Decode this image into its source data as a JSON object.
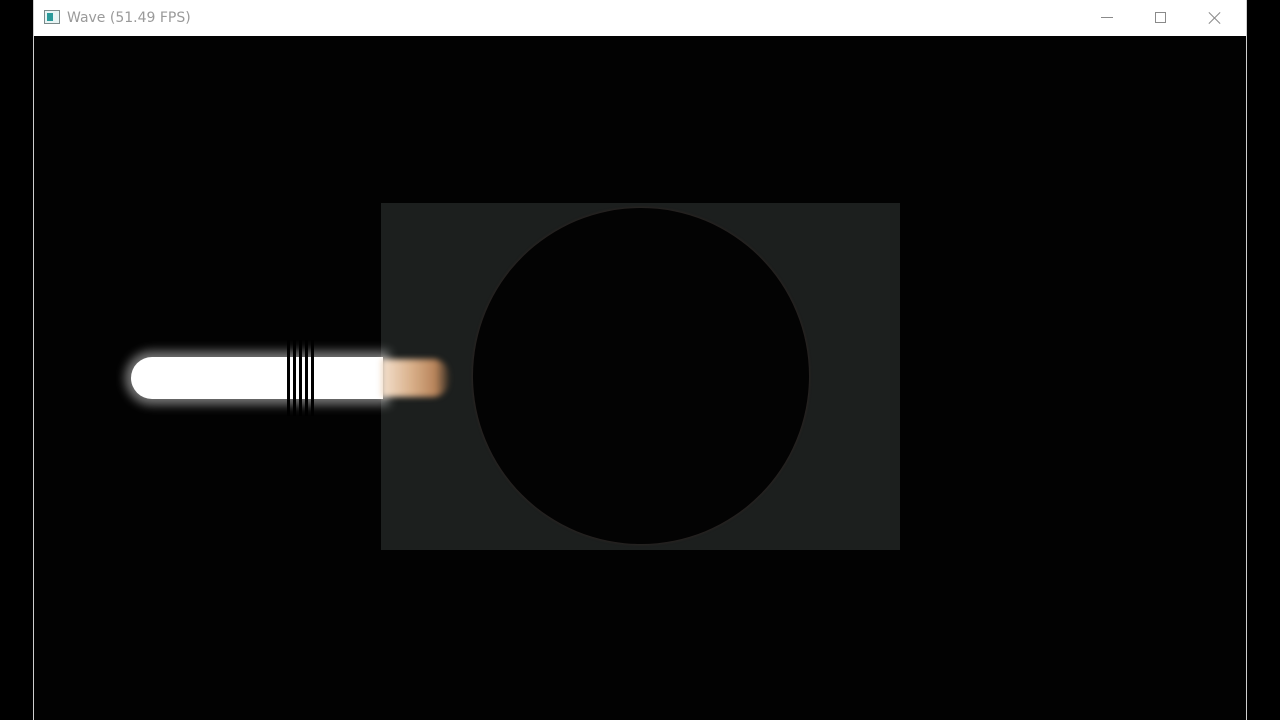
{
  "window": {
    "title": "Wave (51.49 FPS)",
    "icon": "app-window-icon",
    "controls": {
      "minimize_icon": "minimize-icon",
      "maximize_icon": "maximize-icon",
      "close_icon": "close-icon"
    }
  },
  "scene": {
    "background_color": "#020202",
    "medium_color": "#1c1f1e",
    "lens_color": "#030303",
    "beam_color": "#ffffff",
    "beam_tail_color": "#d9b08a"
  }
}
